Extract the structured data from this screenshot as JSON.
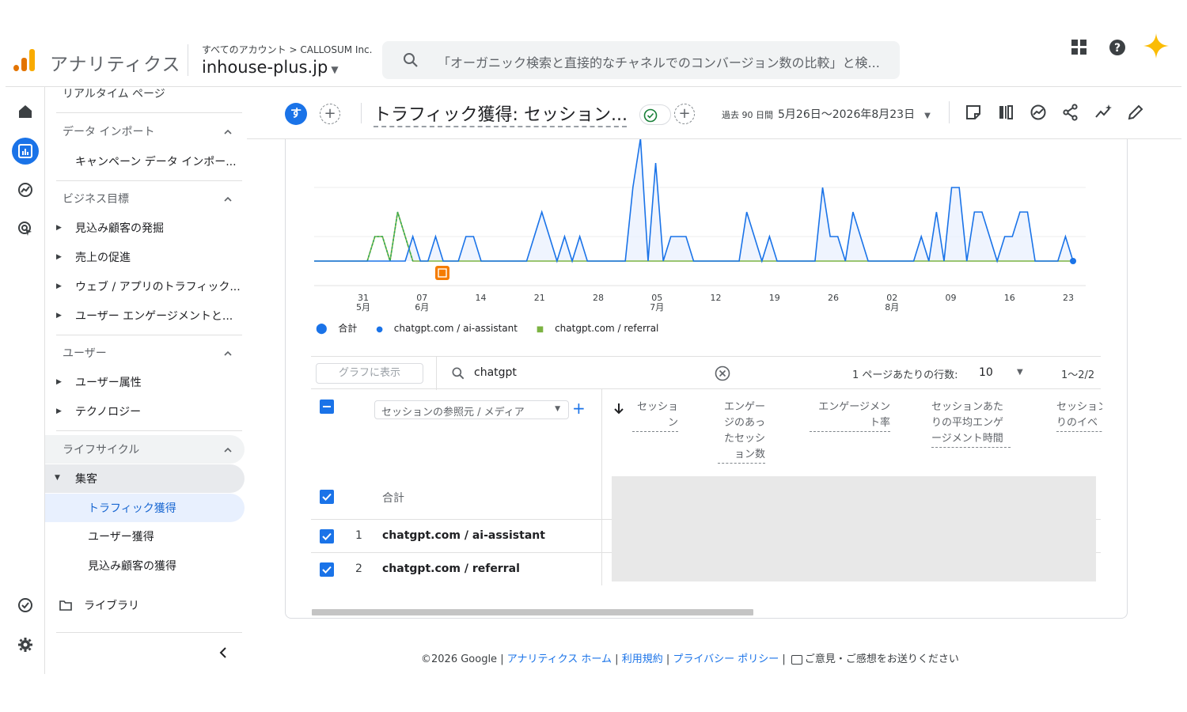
{
  "header": {
    "app_title": "アナリティクス",
    "account_path": "すべてのアカウント > CALLOSUM Inc.",
    "property": "inhouse-plus.jp",
    "search_placeholder": "「オーガニック検索と直接的なチャネルでのコンバージョン数の比較」と検..."
  },
  "rail": {
    "items": [
      "home-icon",
      "reports-icon",
      "explore-icon",
      "advertising-icon",
      "admin-check-icon",
      "settings-icon"
    ]
  },
  "sidebar": {
    "realtime": "リアルタイム ページ",
    "data_import_head": "データ インポート",
    "campaign_import": "キャンペーン データ インポー...",
    "business_goals_head": "ビジネス目標",
    "bg_items": [
      "見込み顧客の発掘",
      "売上の促進",
      "ウェブ / アプリのトラフィック...",
      "ユーザー エンゲージメントと..."
    ],
    "users_head": "ユーザー",
    "users_items": [
      "ユーザー属性",
      "テクノロジー"
    ],
    "lifecycle_head": "ライフサイクル",
    "acquisition": "集客",
    "acq_items": [
      "トラフィック獲得",
      "ユーザー獲得",
      "見込み顧客の獲得"
    ],
    "library": "ライブラリ"
  },
  "report": {
    "avatar": "す",
    "title": "トラフィック獲得: セッション...",
    "date_prefix": "過去 90 日間",
    "date_range": "5月26日〜2026年8月23日"
  },
  "chart_data": {
    "type": "line",
    "x_tick_labels": [
      {
        "day": "31",
        "month": "5月"
      },
      {
        "day": "07",
        "month": "6月"
      },
      {
        "day": "14",
        "month": ""
      },
      {
        "day": "21",
        "month": ""
      },
      {
        "day": "28",
        "month": ""
      },
      {
        "day": "05",
        "month": "7月"
      },
      {
        "day": "12",
        "month": ""
      },
      {
        "day": "19",
        "month": ""
      },
      {
        "day": "26",
        "month": ""
      },
      {
        "day": "02",
        "month": "8月"
      },
      {
        "day": "09",
        "month": ""
      },
      {
        "day": "16",
        "month": ""
      },
      {
        "day": "23",
        "month": ""
      }
    ],
    "y_axis_labels_visible": false,
    "grid": true,
    "legend_position": "bottom-left",
    "series": [
      {
        "name": "合計",
        "color": "#1a73e8"
      },
      {
        "name": "chatgpt.com / ai-assistant",
        "color": "#1a73e8",
        "values": [
          0,
          0,
          0,
          0,
          0,
          0,
          0,
          0,
          0,
          0,
          0,
          0,
          0,
          1,
          0,
          0,
          1,
          0,
          0,
          0,
          1,
          1,
          0,
          0,
          0,
          0,
          0,
          0,
          0,
          1,
          2,
          1,
          0,
          1,
          0,
          1,
          0,
          0,
          0,
          0,
          0,
          0,
          3,
          5,
          0,
          4,
          0,
          1,
          1,
          1,
          0,
          0,
          0,
          0,
          0,
          0,
          0,
          2,
          1,
          0,
          1,
          0,
          0,
          0,
          0,
          0,
          0,
          3,
          1,
          1,
          0,
          2,
          1,
          0,
          0,
          0,
          0,
          0,
          0,
          0,
          1,
          0,
          2,
          0,
          3,
          3,
          0,
          2,
          2,
          1,
          0,
          1,
          1,
          2,
          2,
          0,
          0,
          0,
          0,
          1,
          0
        ]
      },
      {
        "name": "chatgpt.com / referral",
        "color": "#34a853",
        "values": [
          0,
          0,
          0,
          0,
          0,
          0,
          0,
          0,
          1,
          1,
          0,
          2,
          1,
          0,
          0,
          0,
          0,
          0,
          0,
          0,
          0,
          0,
          0,
          0,
          0,
          0,
          0,
          0,
          0,
          0,
          0,
          0,
          0,
          0,
          0,
          0,
          0,
          0,
          0,
          0,
          0,
          0,
          0,
          0,
          0,
          0,
          0,
          0,
          0,
          0,
          0,
          0,
          0,
          0,
          0,
          0,
          0,
          0,
          0,
          0,
          0,
          0,
          0,
          0,
          0,
          0,
          0,
          0,
          0,
          0,
          0,
          0,
          0,
          0,
          0,
          0,
          0,
          0,
          0,
          0,
          0,
          0,
          0,
          0,
          0,
          0,
          0,
          0,
          0,
          0,
          0,
          0,
          0,
          0,
          0,
          0,
          0,
          0,
          0,
          0,
          0
        ]
      }
    ]
  },
  "table": {
    "show_in_graph": "グラフに表示",
    "search_value": "chatgpt",
    "rows_per_page_label": "1 ページあたりの行数:",
    "rows_per_page": "10",
    "pager": "1〜2/2",
    "dimension_header": "セッションの参照元 / メディア",
    "columns": [
      "セッション",
      "エンゲージのあったセッション数",
      "エンゲージメント率",
      "セッションあたりの平均エンゲージメント時間",
      "セッションあたりのイベ"
    ],
    "total_label": "合計",
    "rows": [
      {
        "index": "1",
        "source": "chatgpt.com / ai-assistant"
      },
      {
        "index": "2",
        "source": "chatgpt.com / referral"
      }
    ]
  },
  "footer": {
    "copyright": "©2026 Google |",
    "links": [
      "アナリティクス ホーム",
      "利用規約",
      "プライバシー ポリシー"
    ],
    "feedback": "ご意見・ご感想をお送りください"
  }
}
